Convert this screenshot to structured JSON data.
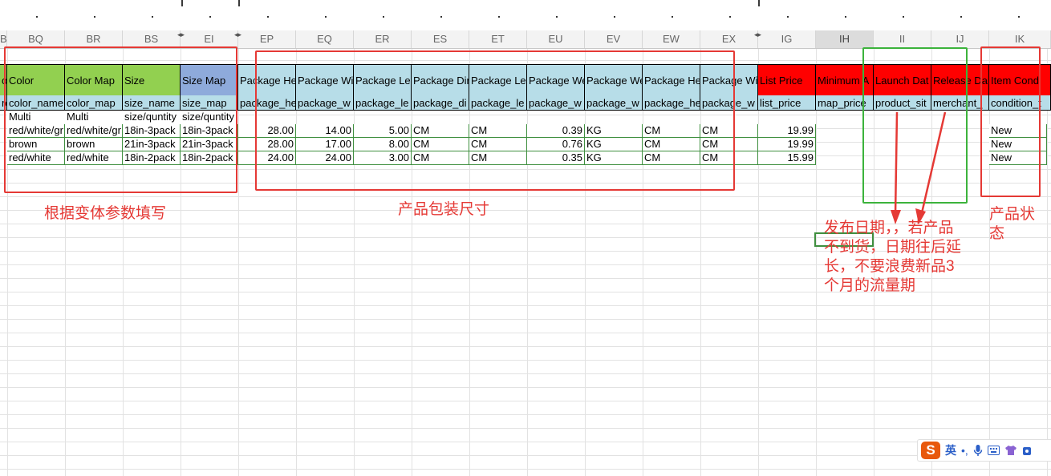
{
  "column_headers": [
    "BP",
    "BQ",
    "BR",
    "BS",
    "EI",
    "EP",
    "EQ",
    "ER",
    "ES",
    "ET",
    "EU",
    "EV",
    "EW",
    "EX",
    "IG",
    "IH",
    "II",
    "IJ",
    "IK"
  ],
  "header_row": {
    "partial_left": "o",
    "color": "Color",
    "color_map": "Color Map",
    "size": "Size",
    "size_map": "Size Map",
    "package_height": "Package He",
    "package_width": "Package Wi",
    "package_length": "Package Le",
    "package_dim_unit": "Package Dir",
    "package_length_unit": "Package Le",
    "package_weight": "Package We",
    "package_weight_unit": "Package We",
    "package_height_unit": "Package He",
    "package_width_unit": "Package Wi",
    "list_price": "List Price",
    "min_adv_price": "Minimum A",
    "launch_date": "Launch Dat",
    "release_date": "Release Da",
    "item_condition": "Item Cond"
  },
  "field_row": {
    "partial_left": "ro",
    "color": "color_name",
    "color_map": "color_map",
    "size": "size_name",
    "size_map": "size_map",
    "package_height": "package_he",
    "package_width": "package_w",
    "package_length": "package_le",
    "package_dim_unit": "package_di",
    "package_length_unit": "package_le",
    "package_weight": "package_w",
    "package_weight_unit": "package_w",
    "package_height_unit": "package_he",
    "package_width_unit": "package_w",
    "list_price": "list_price",
    "min_adv_price": "map_price",
    "launch_date": "product_sit",
    "release_date": "merchant_",
    "item_condition": "condition_t"
  },
  "example_row": {
    "color": "Multi",
    "color_map": "Multi",
    "size": "size/quntity",
    "size_map": "size/quntity"
  },
  "rows": [
    {
      "color": "red/white/gr",
      "color_map": "red/white/gr",
      "size": "18in-3pack",
      "size_map": "18in-3pack",
      "ph": "28.00",
      "pw": "14.00",
      "pl": "5.00",
      "dim": "CM",
      "len_u": "CM",
      "wt": "0.39",
      "wt_u": "KG",
      "h_u": "CM",
      "w_u": "CM",
      "price": "19.99",
      "cond": "New"
    },
    {
      "color": "brown",
      "color_map": "brown",
      "size": "21in-3pack",
      "size_map": "21in-3pack",
      "ph": "28.00",
      "pw": "17.00",
      "pl": "8.00",
      "dim": "CM",
      "len_u": "CM",
      "wt": "0.76",
      "wt_u": "KG",
      "h_u": "CM",
      "w_u": "CM",
      "price": "19.99",
      "cond": "New"
    },
    {
      "color": "red/white",
      "color_map": "red/white",
      "size": "18in-2pack",
      "size_map": "18in-2pack",
      "ph": "24.00",
      "pw": "24.00",
      "pl": "3.00",
      "dim": "CM",
      "len_u": "CM",
      "wt": "0.35",
      "wt_u": "KG",
      "h_u": "CM",
      "w_u": "CM",
      "price": "15.99",
      "cond": "New"
    }
  ],
  "annotations": {
    "variant_note": "根据变体参数填写",
    "package_note": "产品包装尺寸",
    "launch_note_line1": "发布日期，，若产品",
    "launch_note_line2": "不到货，日期往后延",
    "launch_note_line3": "长，不要浪费新品3",
    "launch_note_line4": "个月的流量期",
    "condition_note_line1": "产品状",
    "condition_note_line2": "态"
  },
  "ime": {
    "logo": "S",
    "lang": "英",
    "punct": "•,"
  },
  "colors": {
    "green_header": "#92d050",
    "blue_header": "#8eaadb",
    "light_blue": "#b7dde8",
    "red_header": "#ff0000",
    "annotation_red": "#e53935",
    "annotation_green": "#3cb33c"
  }
}
